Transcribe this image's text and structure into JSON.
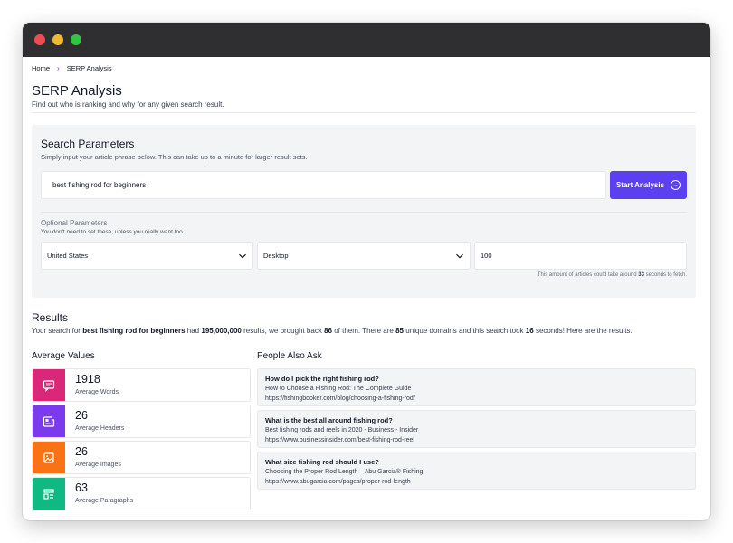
{
  "breadcrumb": {
    "home": "Home",
    "separator": "›",
    "current": "SERP Analysis"
  },
  "page": {
    "title": "SERP Analysis",
    "subtitle": "Find out who is ranking and why for any given search result."
  },
  "search_params": {
    "title": "Search Parameters",
    "subtitle": "Simply input your article phrase below. This can take up to a minute for larger result sets.",
    "query": "best fishing rod for beginners",
    "button_label": "Start Analysis",
    "optional_title": "Optional Parameters",
    "optional_subtitle": "You don't need to set these, unless you really want too.",
    "country": "United States",
    "device": "Desktop",
    "count": "100",
    "note_prefix": "This amount of articles could take around",
    "note_seconds": "33",
    "note_suffix": "seconds to fetch."
  },
  "results": {
    "title": "Results",
    "t1": "Your search for",
    "query": "best fishing rod for beginners",
    "t2": "had",
    "total": "195,000,000",
    "t3": "results, we brought back",
    "returned": "86",
    "t4": "of them. There are",
    "domains": "85",
    "t5": "unique domains and this search took",
    "seconds": "16",
    "t6": "seconds! Here are the results."
  },
  "averages": {
    "title": "Average Values",
    "items": [
      {
        "value": "1918",
        "label": "Average Words",
        "icon": "message-icon",
        "color": "#db2777"
      },
      {
        "value": "26",
        "label": "Average Headers",
        "icon": "newspaper-icon",
        "color": "#7c3aed"
      },
      {
        "value": "26",
        "label": "Average Images",
        "icon": "image-icon",
        "color": "#f97316"
      },
      {
        "value": "63",
        "label": "Average Paragraphs",
        "icon": "layout-icon",
        "color": "#10b981"
      }
    ]
  },
  "paa": {
    "title": "People Also Ask",
    "items": [
      {
        "question": "How do I pick the right fishing rod?",
        "page_title": "How to Choose a Fishing Rod: The Complete Guide",
        "url": "https://fishingbooker.com/blog/choosing-a-fishing-rod/"
      },
      {
        "question": "What is the best all around fishing rod?",
        "page_title": "Best fishing rods and reels in 2020 - Business - Insider",
        "url": "https://www.businessinsider.com/best-fishing-rod-reel"
      },
      {
        "question": "What size fishing rod should I use?",
        "page_title": "Choosing the Proper Rod Length – Abu Garcia® Fishing",
        "url": "https://www.abugarcia.com/pages/proper-rod-length"
      }
    ]
  }
}
